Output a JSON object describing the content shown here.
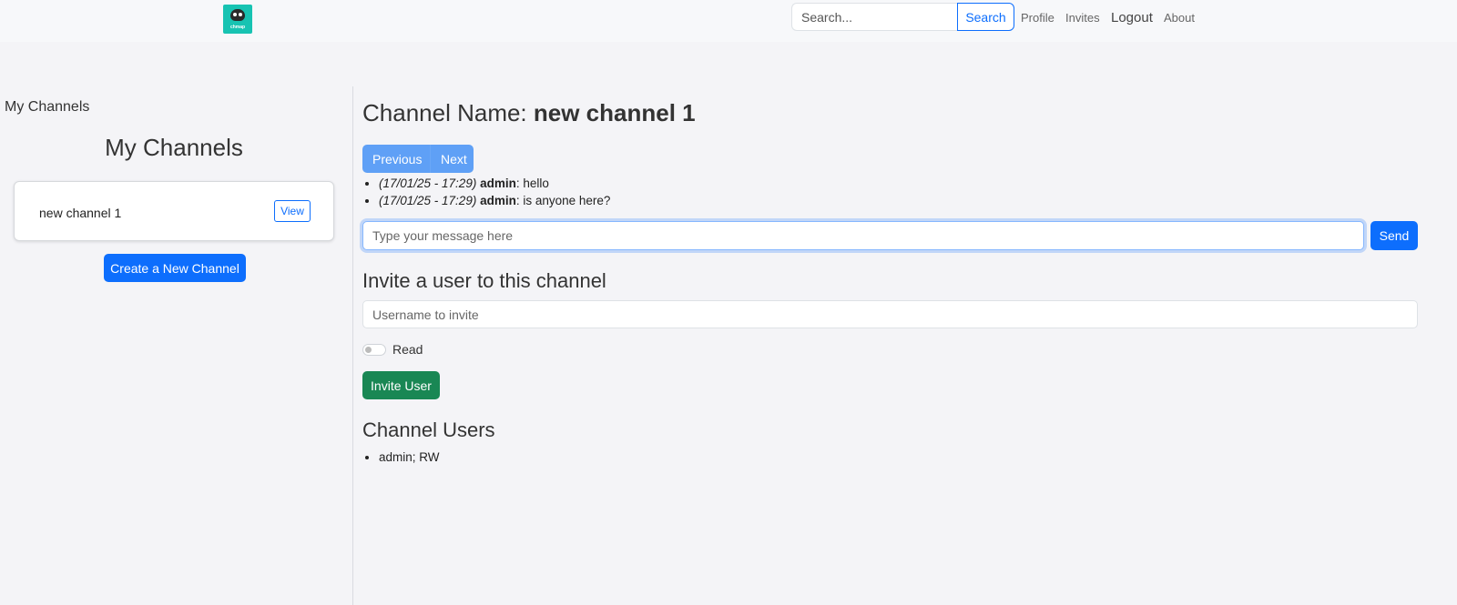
{
  "navbar": {
    "logo_text": "chmap",
    "search_placeholder": "Search...",
    "search_button": "Search",
    "links": {
      "profile": "Profile",
      "invites": "Invites",
      "logout": "Logout",
      "about": "About"
    }
  },
  "sidebar": {
    "label": "My Channels",
    "heading": "My Channels",
    "channels": [
      {
        "name": "new channel 1",
        "view_label": "View"
      }
    ],
    "create_button": "Create a New Channel"
  },
  "channel": {
    "title_prefix": "Channel Name: ",
    "name": "new channel 1",
    "pager": {
      "previous": "Previous",
      "next": "Next"
    },
    "messages": [
      {
        "timestamp": "(17/01/25 - 17:29)",
        "user": "admin",
        "text": ": hello"
      },
      {
        "timestamp": "(17/01/25 - 17:29)",
        "user": "admin",
        "text": ": is anyone here?"
      }
    ],
    "message_placeholder": "Type your message here",
    "send_button": "Send"
  },
  "invite": {
    "heading": "Invite a user to this channel",
    "username_placeholder": "Username to invite",
    "toggle_label": "Read",
    "toggle_on": false,
    "button": "Invite User"
  },
  "users": {
    "heading": "Channel Users",
    "list": [
      "admin; RW"
    ]
  },
  "colors": {
    "primary": "#0d6efd",
    "success": "#198754",
    "pager": "#5fa0f6",
    "logo": "#17c3b2"
  }
}
